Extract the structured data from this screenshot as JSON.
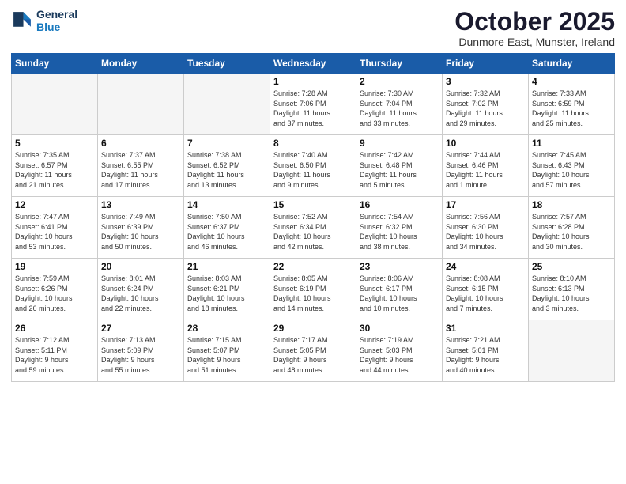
{
  "header": {
    "logo_line1": "General",
    "logo_line2": "Blue",
    "month_title": "October 2025",
    "subtitle": "Dunmore East, Munster, Ireland"
  },
  "days_of_week": [
    "Sunday",
    "Monday",
    "Tuesday",
    "Wednesday",
    "Thursday",
    "Friday",
    "Saturday"
  ],
  "weeks": [
    [
      {
        "day": "",
        "info": ""
      },
      {
        "day": "",
        "info": ""
      },
      {
        "day": "",
        "info": ""
      },
      {
        "day": "1",
        "info": "Sunrise: 7:28 AM\nSunset: 7:06 PM\nDaylight: 11 hours\nand 37 minutes."
      },
      {
        "day": "2",
        "info": "Sunrise: 7:30 AM\nSunset: 7:04 PM\nDaylight: 11 hours\nand 33 minutes."
      },
      {
        "day": "3",
        "info": "Sunrise: 7:32 AM\nSunset: 7:02 PM\nDaylight: 11 hours\nand 29 minutes."
      },
      {
        "day": "4",
        "info": "Sunrise: 7:33 AM\nSunset: 6:59 PM\nDaylight: 11 hours\nand 25 minutes."
      }
    ],
    [
      {
        "day": "5",
        "info": "Sunrise: 7:35 AM\nSunset: 6:57 PM\nDaylight: 11 hours\nand 21 minutes."
      },
      {
        "day": "6",
        "info": "Sunrise: 7:37 AM\nSunset: 6:55 PM\nDaylight: 11 hours\nand 17 minutes."
      },
      {
        "day": "7",
        "info": "Sunrise: 7:38 AM\nSunset: 6:52 PM\nDaylight: 11 hours\nand 13 minutes."
      },
      {
        "day": "8",
        "info": "Sunrise: 7:40 AM\nSunset: 6:50 PM\nDaylight: 11 hours\nand 9 minutes."
      },
      {
        "day": "9",
        "info": "Sunrise: 7:42 AM\nSunset: 6:48 PM\nDaylight: 11 hours\nand 5 minutes."
      },
      {
        "day": "10",
        "info": "Sunrise: 7:44 AM\nSunset: 6:46 PM\nDaylight: 11 hours\nand 1 minute."
      },
      {
        "day": "11",
        "info": "Sunrise: 7:45 AM\nSunset: 6:43 PM\nDaylight: 10 hours\nand 57 minutes."
      }
    ],
    [
      {
        "day": "12",
        "info": "Sunrise: 7:47 AM\nSunset: 6:41 PM\nDaylight: 10 hours\nand 53 minutes."
      },
      {
        "day": "13",
        "info": "Sunrise: 7:49 AM\nSunset: 6:39 PM\nDaylight: 10 hours\nand 50 minutes."
      },
      {
        "day": "14",
        "info": "Sunrise: 7:50 AM\nSunset: 6:37 PM\nDaylight: 10 hours\nand 46 minutes."
      },
      {
        "day": "15",
        "info": "Sunrise: 7:52 AM\nSunset: 6:34 PM\nDaylight: 10 hours\nand 42 minutes."
      },
      {
        "day": "16",
        "info": "Sunrise: 7:54 AM\nSunset: 6:32 PM\nDaylight: 10 hours\nand 38 minutes."
      },
      {
        "day": "17",
        "info": "Sunrise: 7:56 AM\nSunset: 6:30 PM\nDaylight: 10 hours\nand 34 minutes."
      },
      {
        "day": "18",
        "info": "Sunrise: 7:57 AM\nSunset: 6:28 PM\nDaylight: 10 hours\nand 30 minutes."
      }
    ],
    [
      {
        "day": "19",
        "info": "Sunrise: 7:59 AM\nSunset: 6:26 PM\nDaylight: 10 hours\nand 26 minutes."
      },
      {
        "day": "20",
        "info": "Sunrise: 8:01 AM\nSunset: 6:24 PM\nDaylight: 10 hours\nand 22 minutes."
      },
      {
        "day": "21",
        "info": "Sunrise: 8:03 AM\nSunset: 6:21 PM\nDaylight: 10 hours\nand 18 minutes."
      },
      {
        "day": "22",
        "info": "Sunrise: 8:05 AM\nSunset: 6:19 PM\nDaylight: 10 hours\nand 14 minutes."
      },
      {
        "day": "23",
        "info": "Sunrise: 8:06 AM\nSunset: 6:17 PM\nDaylight: 10 hours\nand 10 minutes."
      },
      {
        "day": "24",
        "info": "Sunrise: 8:08 AM\nSunset: 6:15 PM\nDaylight: 10 hours\nand 7 minutes."
      },
      {
        "day": "25",
        "info": "Sunrise: 8:10 AM\nSunset: 6:13 PM\nDaylight: 10 hours\nand 3 minutes."
      }
    ],
    [
      {
        "day": "26",
        "info": "Sunrise: 7:12 AM\nSunset: 5:11 PM\nDaylight: 9 hours\nand 59 minutes."
      },
      {
        "day": "27",
        "info": "Sunrise: 7:13 AM\nSunset: 5:09 PM\nDaylight: 9 hours\nand 55 minutes."
      },
      {
        "day": "28",
        "info": "Sunrise: 7:15 AM\nSunset: 5:07 PM\nDaylight: 9 hours\nand 51 minutes."
      },
      {
        "day": "29",
        "info": "Sunrise: 7:17 AM\nSunset: 5:05 PM\nDaylight: 9 hours\nand 48 minutes."
      },
      {
        "day": "30",
        "info": "Sunrise: 7:19 AM\nSunset: 5:03 PM\nDaylight: 9 hours\nand 44 minutes."
      },
      {
        "day": "31",
        "info": "Sunrise: 7:21 AM\nSunset: 5:01 PM\nDaylight: 9 hours\nand 40 minutes."
      },
      {
        "day": "",
        "info": ""
      }
    ]
  ]
}
